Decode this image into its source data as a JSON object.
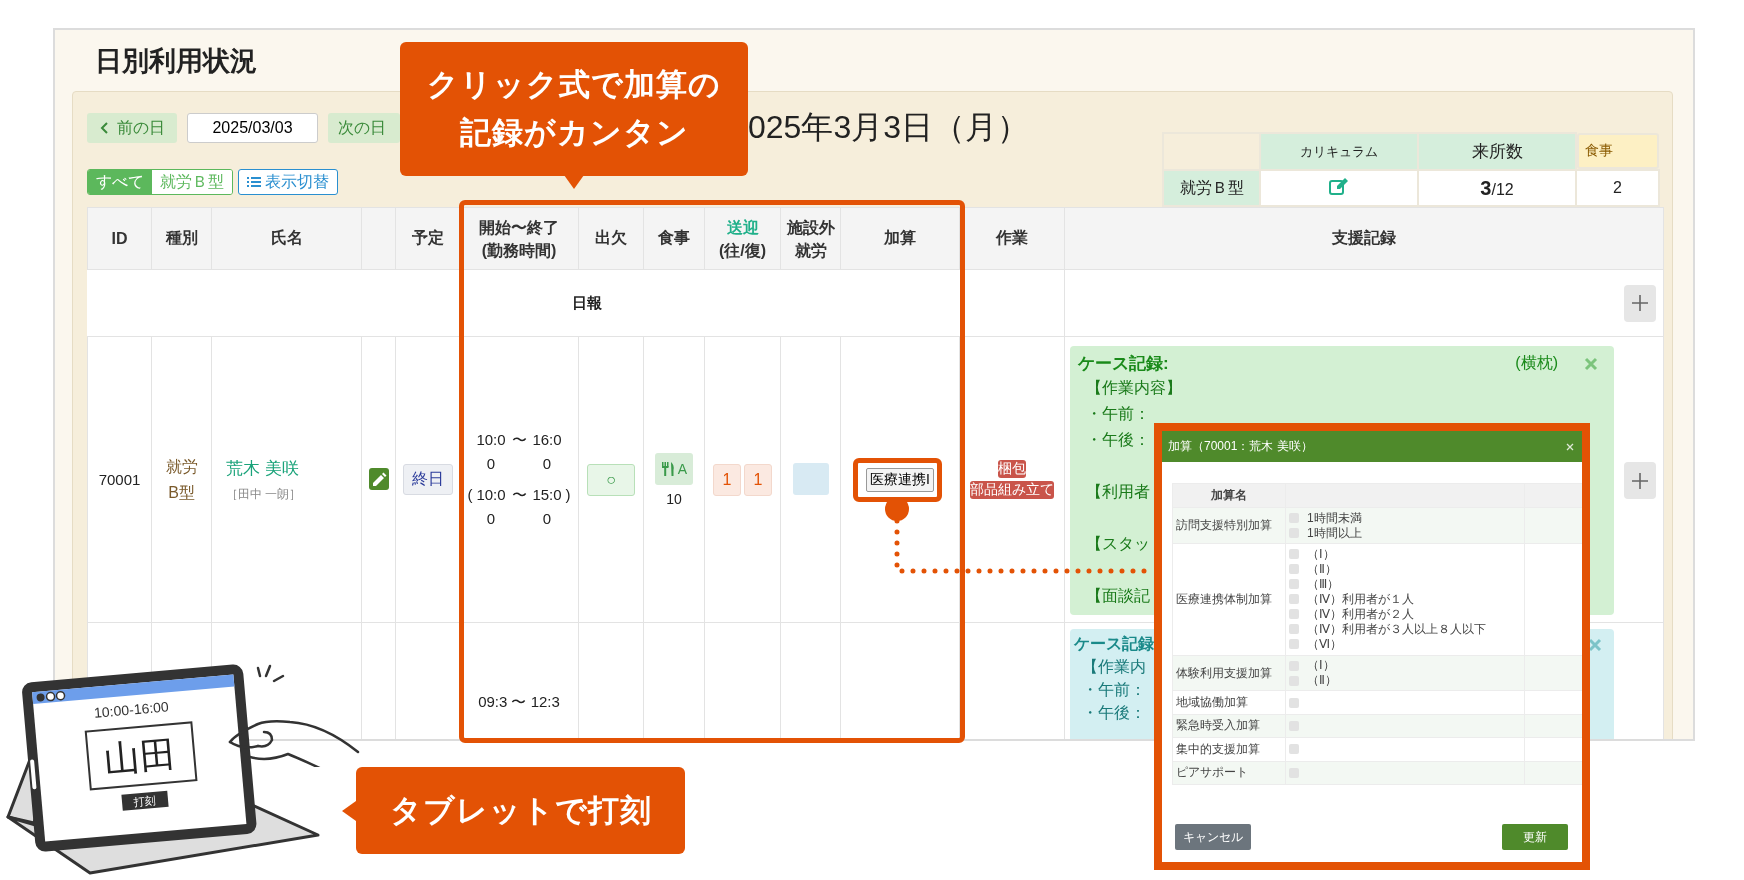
{
  "page_title": "日別利用状況",
  "nav": {
    "prev": "前の日",
    "date": "2025/03/03",
    "next": "次の日",
    "heading": "025年3月3日（月）"
  },
  "filters": [
    {
      "label": "すべて",
      "selected": true
    },
    {
      "label": "就労Ｂ型",
      "selected": false
    }
  ],
  "view_toggle": "表示切替",
  "summary": {
    "headers": [
      "カリキュラム",
      "来所数",
      "食事"
    ],
    "row_label": "就労Ｂ型",
    "visits": "3",
    "capacity": "/12",
    "meals": "2"
  },
  "table": {
    "columns": [
      {
        "kind": "text",
        "label": "ID"
      },
      {
        "kind": "text",
        "label": "種別"
      },
      {
        "kind": "text",
        "label": "氏名"
      },
      {
        "kind": "blank"
      },
      {
        "kind": "text",
        "label": "予定"
      },
      {
        "kind": "text",
        "label": "開始〜終了",
        "sublabel": "(勤務時間)"
      },
      {
        "kind": "text",
        "label": "出欠"
      },
      {
        "kind": "text",
        "label": "食事"
      },
      {
        "kind": "text",
        "label": "送迎",
        "sublabel": "(往/復)",
        "accent": true
      },
      {
        "kind": "text",
        "label": "施設外",
        "sublabel": "就労"
      },
      {
        "kind": "text",
        "label": "加算"
      },
      {
        "kind": "text",
        "label": "作業"
      },
      {
        "kind": "text",
        "label": "支援記録"
      }
    ],
    "daily_report": "日報",
    "rows": [
      {
        "kind": "full",
        "id": "70001",
        "type": "就労B型",
        "name": "荒木 美咲",
        "staff": "［田中 一朗］",
        "schedule": "終日",
        "work_time": {
          "start": "10:00",
          "end": "16:00",
          "separator": "〜"
        },
        "planned_time": {
          "start": "10:00",
          "end": "15:00",
          "separator": "〜",
          "prefix": "(",
          "suffix": ")"
        },
        "attendance": "○",
        "meal": {
          "plan": "A",
          "count": "10"
        },
        "transport": [
          "1",
          "1"
        ],
        "addition": "医療連携I",
        "tasks": [
          "梱包",
          "部品組み立て"
        ],
        "record": {
          "title": "ケース記録:",
          "author": "(横枕)",
          "color": "#d3f0d3",
          "sections": [
            [
              "【作業内容】",
              "・午前：",
              "・午後："
            ],
            [
              "【利用者"
            ],
            [
              "【スタッ"
            ],
            [
              "【面談記"
            ]
          ]
        }
      },
      {
        "kind": "partial",
        "time_text": "09:3 〜 12:3",
        "record": {
          "title": "ケース記録",
          "color": "#d3eff2",
          "sections": [
            [
              "【作業内",
              "・午前：",
              "・午後："
            ]
          ]
        }
      }
    ]
  },
  "callouts": [
    {
      "lines": [
        "クリック式で加算の",
        "記録がカンタン"
      ]
    },
    {
      "lines": [
        "タブレットで打刻"
      ]
    }
  ],
  "dialog": {
    "title": "加算（70001：荒木 美咲）",
    "header": "加算名",
    "items": [
      {
        "name": "訪問支援特別加算",
        "options": [
          {
            "label": "1時間未満",
            "checked": false
          },
          {
            "label": "1時間以上",
            "checked": false
          }
        ]
      },
      {
        "name": "医療連携体制加算",
        "options": [
          {
            "label": "（Ⅰ）",
            "checked": false
          },
          {
            "label": "（Ⅱ）",
            "checked": false
          },
          {
            "label": "（Ⅲ）",
            "checked": false
          },
          {
            "label": "（Ⅳ）利用者が１人",
            "checked": false
          },
          {
            "label": "（Ⅳ）利用者が２人",
            "checked": false
          },
          {
            "label": "（Ⅳ）利用者が３人以上８人以下",
            "checked": false
          },
          {
            "label": "（Ⅵ）",
            "checked": false
          }
        ]
      },
      {
        "name": "体験利用支援加算",
        "options": [
          {
            "label": "（Ⅰ）",
            "checked": false
          },
          {
            "label": "（Ⅱ）",
            "checked": false
          }
        ]
      },
      {
        "name": "地域協働加算",
        "options": [
          {
            "checked": false
          }
        ]
      },
      {
        "name": "緊急時受入加算",
        "options": [
          {
            "checked": false
          }
        ]
      },
      {
        "name": "集中的支援加算",
        "options": [
          {
            "checked": false
          }
        ]
      },
      {
        "name": "ピアサポート",
        "options": [
          {
            "checked": false
          }
        ]
      }
    ],
    "cancel": "キャンセル",
    "submit": "更新"
  },
  "tablet": {
    "time": "10:00-16:00",
    "name": "山田",
    "button": "打刻"
  }
}
